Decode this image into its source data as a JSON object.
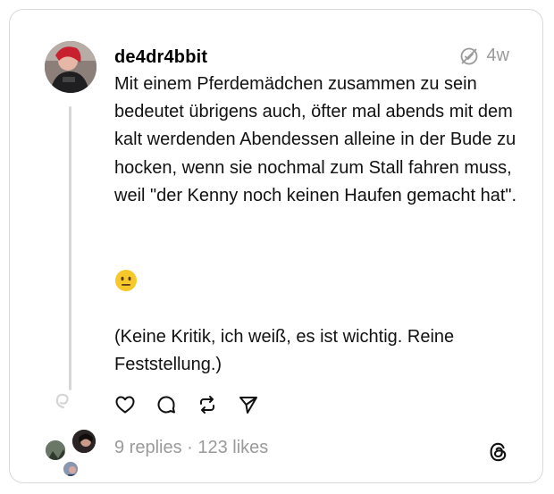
{
  "post": {
    "username": "de4dr4bbit",
    "time": "4w",
    "paragraph1": "Mit einem Pferdemädchen zusammen zu sein bedeutet übrigens auch, öfter mal abends mit dem kalt werdenden Abendessen alleine in der Bude zu hocken, wenn sie nochmal zum Stall fahren muss, weil \"der Kenny noch keinen Haufen gemacht hat\".",
    "emoji": "😐",
    "paragraph3": "(Keine Kritik, ich weiß, es ist wichtig. Reine Feststellung.)"
  },
  "footer": {
    "stats": "9 replies · 123 likes"
  },
  "icons": {
    "like": "heart-icon",
    "reply": "comment-icon",
    "repost": "repost-icon",
    "share": "send-icon",
    "status": "muted-icon",
    "brand": "threads-logo"
  },
  "colors": {
    "text": "#111111",
    "muted": "#9a9a9a",
    "border": "#d9d9d9",
    "emoji": "#f5c518"
  }
}
